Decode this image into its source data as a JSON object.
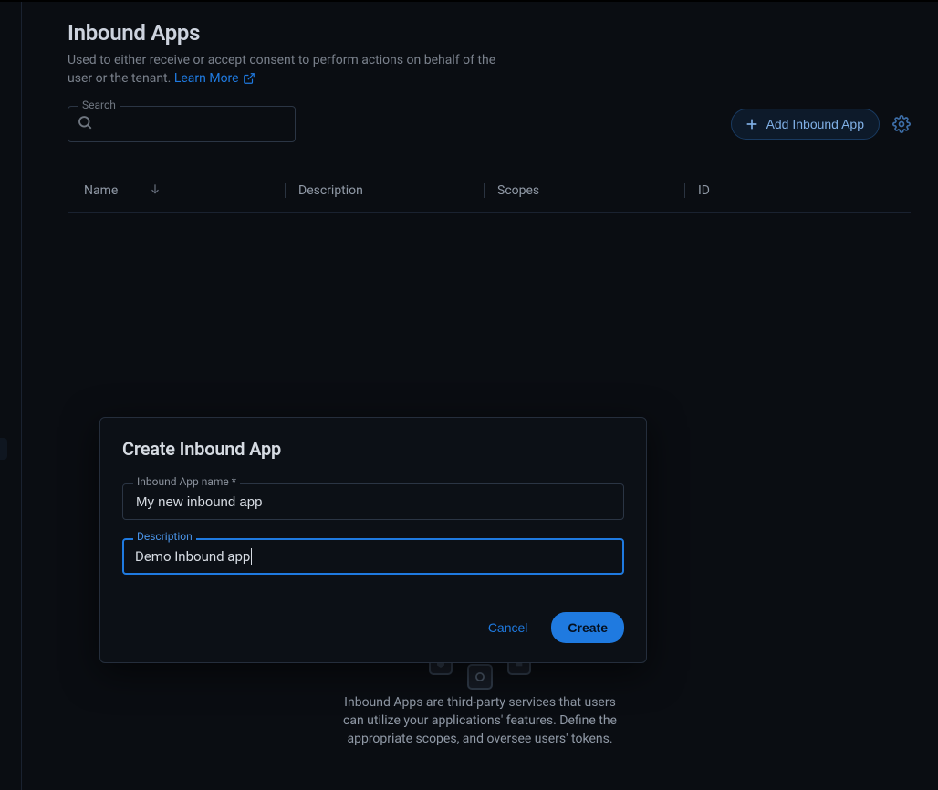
{
  "header": {
    "title": "Inbound Apps",
    "description": "Used to either receive or accept consent to perform actions on behalf of the user or the tenant.",
    "learn_more_label": "Learn More"
  },
  "search": {
    "label": "Search",
    "value": ""
  },
  "add_button_label": "Add Inbound App",
  "table": {
    "columns": {
      "name": "Name",
      "description": "Description",
      "scopes": "Scopes",
      "id": "ID"
    }
  },
  "empty_state": {
    "text": "Inbound Apps are third-party services that users can utilize your applications' features. Define the appropriate scopes, and oversee users' tokens."
  },
  "modal": {
    "title": "Create Inbound App",
    "fields": {
      "name": {
        "label": "Inbound App name *",
        "value": "My new inbound app"
      },
      "description": {
        "label": "Description",
        "value": "Demo Inbound app"
      }
    },
    "actions": {
      "cancel": "Cancel",
      "create": "Create"
    }
  }
}
